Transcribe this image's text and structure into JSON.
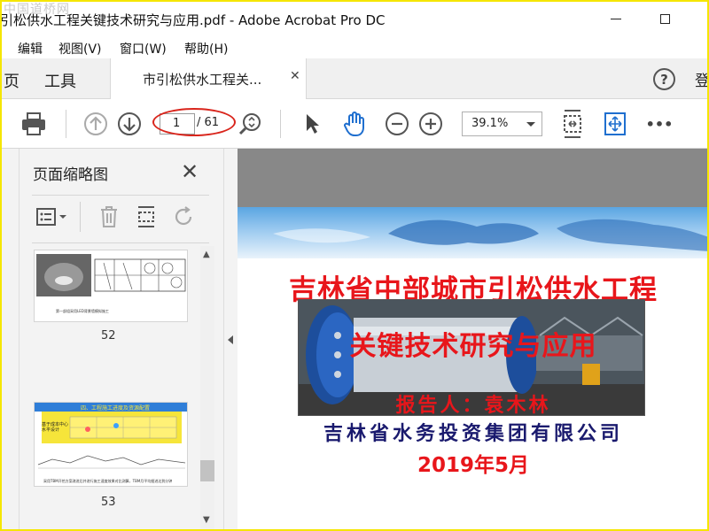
{
  "window": {
    "title": "引松供水工程关键技术研究与应用.pdf - Adobe Acrobat Pro DC",
    "watermark": "中国道桥网"
  },
  "menu": [
    "编辑",
    "视图(V)",
    "窗口(W)",
    "帮助(H)"
  ],
  "tabs": {
    "home_partial": "页",
    "tools": "工具",
    "document": "市引松供水工程关...",
    "login_partial": "登"
  },
  "toolbar": {
    "current_page": "1",
    "total_pages": "/ 61",
    "zoom": "39.1%",
    "more": "•••"
  },
  "thumbnails": {
    "title": "页面缩略图",
    "pages": [
      {
        "number": "52",
        "caption": "第一部组采用LED背景墙模拟施工"
      },
      {
        "number": "53",
        "caption": "采用TBM开挖方案改进后并进行施工速度效果对比测算，TBM月平均掘进达到分钟"
      }
    ],
    "page53_banner": "四、工程施工进度及资源配置",
    "page53_label": "基于成本中心水平设计"
  },
  "slide": {
    "title_line1": "吉林省中部城市引松供水工程",
    "title_line2": "关键技术研究与应用",
    "reporter": "报告人：袁木林",
    "organization": "吉林省水务投资集团有限公司",
    "date": "2019年5月"
  },
  "colors": {
    "accent_red": "#e8161b",
    "annotation_red": "#d9251c",
    "dark_navy": "#1a1a6e",
    "frame_yellow": "#f5e600"
  }
}
